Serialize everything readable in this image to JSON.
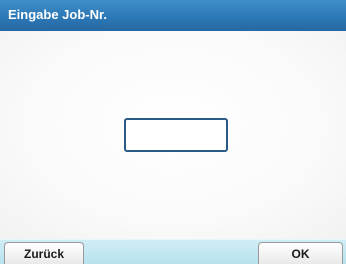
{
  "window": {
    "title": "Eingabe Job-Nr."
  },
  "input": {
    "value": ""
  },
  "softkeys": {
    "back_label": "Zurück",
    "ok_label": "OK"
  },
  "colors": {
    "title_bar": "#2c78b6",
    "softkey_bar": "#c4e8f2",
    "input_border": "#2a5a86"
  }
}
